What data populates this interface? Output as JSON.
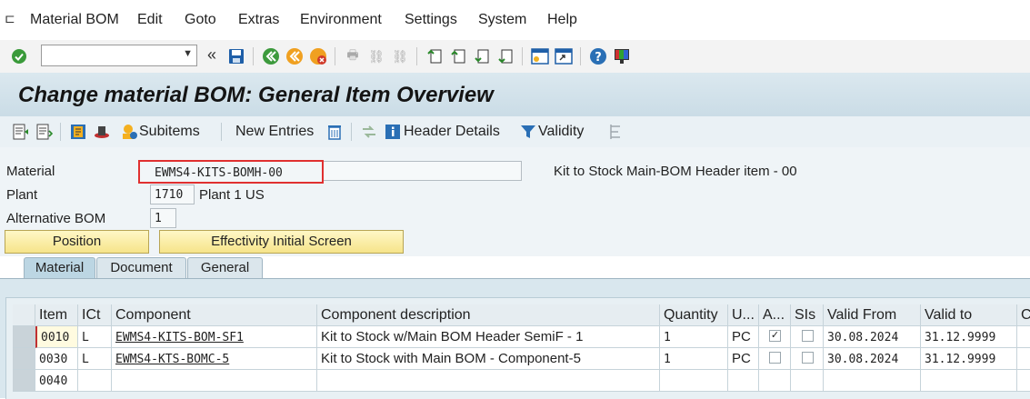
{
  "menu": {
    "items": [
      "Material BOM",
      "Edit",
      "Goto",
      "Extras",
      "Environment",
      "Settings",
      "System",
      "Help"
    ]
  },
  "toolbar": {
    "command_value": "",
    "nav_glyph": "«"
  },
  "title": "Change material BOM: General Item Overview",
  "app_toolbar": {
    "subitems": "Subitems",
    "new_entries": "New Entries",
    "header_details": "Header Details",
    "validity": "Validity"
  },
  "header": {
    "material_label": "Material",
    "material_value": "EWMS4-KITS-BOMH-00",
    "material_desc": "Kit to Stock Main-BOM Header item - 00",
    "plant_label": "Plant",
    "plant_value": "1710",
    "plant_desc": "Plant 1 US",
    "altbom_label": "Alternative BOM",
    "altbom_value": "1"
  },
  "buttons": {
    "position": "Position",
    "effectivity": "Effectivity Initial Screen"
  },
  "tabs": [
    "Material",
    "Document",
    "General"
  ],
  "table": {
    "columns": [
      "Item",
      "ICt",
      "Component",
      "Component description",
      "Quantity",
      "U...",
      "A...",
      "SIs",
      "Valid From",
      "Valid to",
      "C"
    ],
    "rows": [
      {
        "item": "0010",
        "ict": "L",
        "component": "EWMS4-KITS-BOM-SF1",
        "desc": "Kit to Stock w/Main BOM Header SemiF - 1",
        "qty": "1",
        "unit": "PC",
        "a": true,
        "sis": false,
        "from": "30.08.2024",
        "to": "31.12.9999"
      },
      {
        "item": "0030",
        "ict": "L",
        "component": "EWMS4-KTS-BOMC-5",
        "desc": "Kit to Stock with Main BOM - Component-5",
        "qty": "1",
        "unit": "PC",
        "a": false,
        "sis": false,
        "from": "30.08.2024",
        "to": "31.12.9999"
      },
      {
        "item": "0040",
        "ict": "",
        "component": "",
        "desc": "",
        "qty": "",
        "unit": "",
        "a": null,
        "sis": null,
        "from": "",
        "to": ""
      }
    ]
  },
  "colors": {
    "highlight_box": "#e03030",
    "button_yellow": "#f6e48a",
    "title_band": "#cadce6"
  }
}
